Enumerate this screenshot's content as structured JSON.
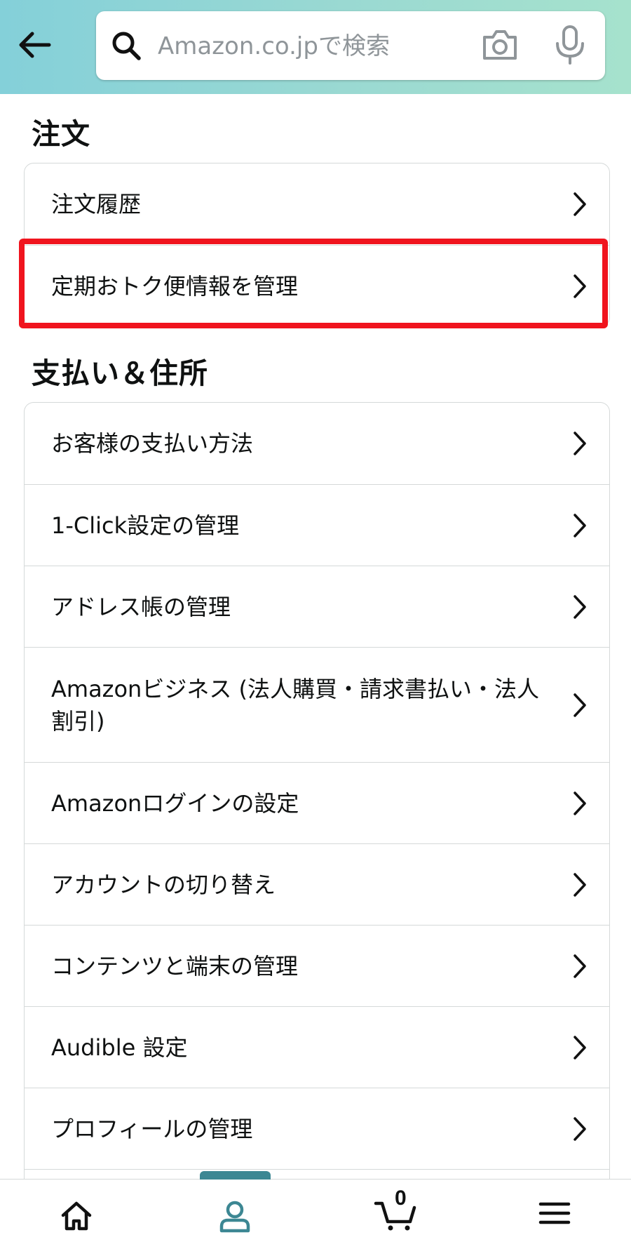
{
  "header": {
    "search_placeholder": "Amazon.co.jpで検索"
  },
  "sections": [
    {
      "title": "注文",
      "items": [
        "注文履歴",
        "定期おトク便情報を管理"
      ]
    },
    {
      "title": "支払い＆住所",
      "items": [
        "お客様の支払い方法",
        "1-Click設定の管理",
        "アドレス帳の管理",
        "Amazonビジネス (法人購買・請求書払い・法人割引)",
        "Amazonログインの設定",
        "アカウントの切り替え",
        "コンテンツと端末の管理",
        "Audible 設定",
        "プロフィールの管理"
      ]
    }
  ],
  "highlighted_item": "定期おトク便情報を管理",
  "bottom_nav": {
    "items": [
      "home-icon",
      "account-icon",
      "cart-icon",
      "menu-icon"
    ],
    "active": "account-icon",
    "cart_count": "0"
  },
  "colors": {
    "header_gradient_start": "#84d0d9",
    "header_gradient_end": "#a6e2cd",
    "highlight_border": "#f0141e",
    "active_nav": "#3c8793"
  }
}
